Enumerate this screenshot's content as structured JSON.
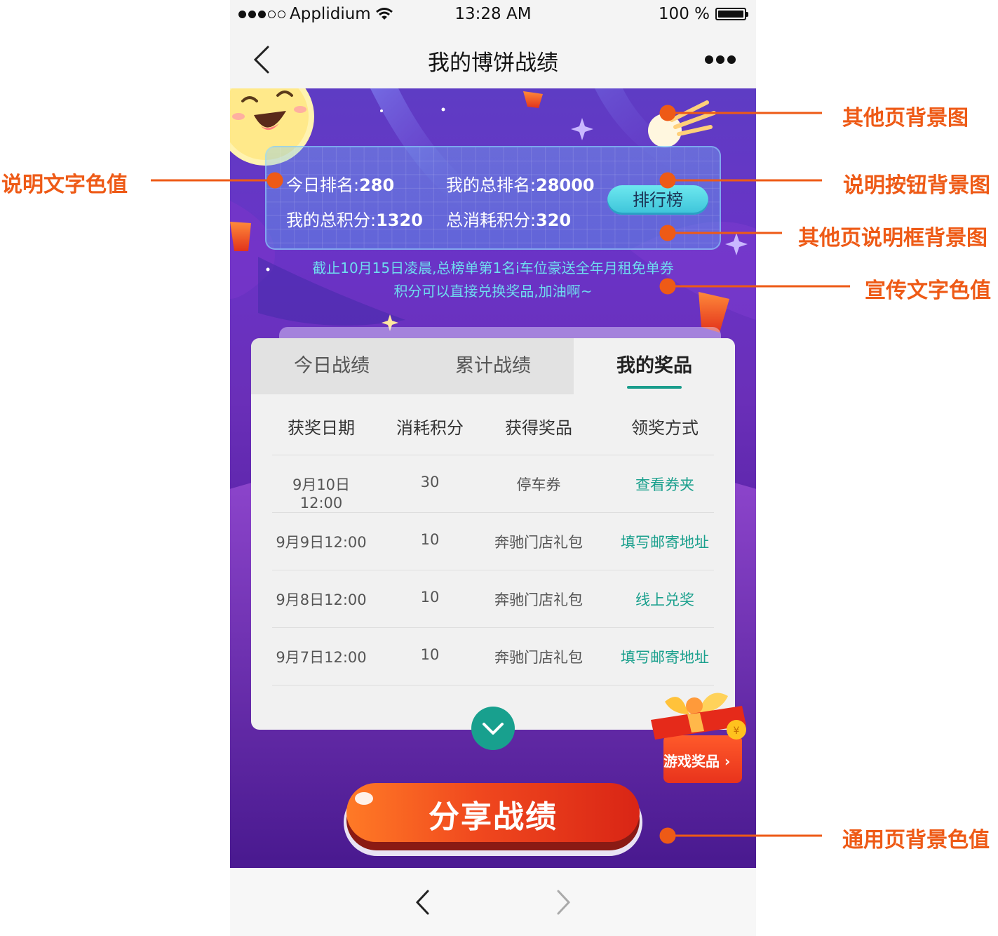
{
  "status_bar": {
    "carrier": "Applidium",
    "time": "13:28 AM",
    "battery": "100 %"
  },
  "nav": {
    "title": "我的博饼战绩",
    "back_icon": "chevron-left-icon",
    "more_icon": "more-dots-icon"
  },
  "info": {
    "today_rank_label": "今日排名:",
    "today_rank": "280",
    "total_rank_label": "我的总排名:",
    "total_rank": "28000",
    "total_points_label": "我的总积分:",
    "total_points": "1320",
    "consumed_points_label": "总消耗积分:",
    "consumed_points": "320",
    "ranking_button": "排行榜"
  },
  "promo": {
    "line1": "截止10月15日凌晨,总榜单第1名i车位豪送全年月租免单券",
    "line2": "积分可以直接兑换奖品,加油啊~"
  },
  "tabs": [
    {
      "label": "今日战绩",
      "active": false
    },
    {
      "label": "累计战绩",
      "active": false
    },
    {
      "label": "我的奖品",
      "active": true
    }
  ],
  "table": {
    "headers": [
      "获奖日期",
      "消耗积分",
      "获得奖品",
      "领奖方式"
    ],
    "rows": [
      {
        "date": "9月10日12:00",
        "points": "30",
        "prize": "停车券",
        "method": "查看券夹"
      },
      {
        "date": "9月9日12:00",
        "points": "10",
        "prize": "奔驰门店礼包",
        "method": "填写邮寄地址"
      },
      {
        "date": "9月8日12:00",
        "points": "10",
        "prize": "奔驰门店礼包",
        "method": "线上兑奖"
      },
      {
        "date": "9月7日12:00",
        "points": "10",
        "prize": "奔驰门店礼包",
        "method": "填写邮寄地址"
      }
    ]
  },
  "gift_badge": {
    "label": "游戏奖品 ›"
  },
  "share_button": "分享战绩",
  "annotations": {
    "left_1": "说明文字色值",
    "right_1": "其他页背景图",
    "right_2": "说明按钮背景图",
    "right_3": "其他页说明框背景图",
    "right_4": "宣传文字色值",
    "right_5": "通用页背景色值"
  },
  "colors": {
    "accent_teal": "#1aa08d",
    "annotation_orange": "#ee5a16",
    "promo_cyan": "#6fdcef",
    "share_red": "#e83a1a",
    "page_purple": "#4c1b93"
  }
}
